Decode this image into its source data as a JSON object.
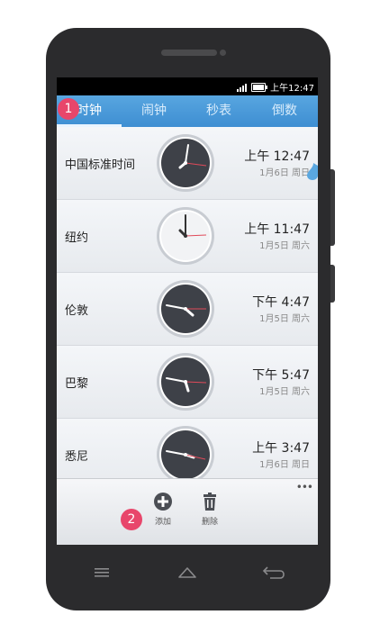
{
  "status_bar": {
    "time": "上午12:47"
  },
  "tabs": [
    {
      "label": "时钟",
      "active": true
    },
    {
      "label": "闹钟",
      "active": false
    },
    {
      "label": "秒表",
      "active": false
    },
    {
      "label": "倒数",
      "active": false
    }
  ],
  "world_clocks": [
    {
      "city": "中国标准时间",
      "time": "上午 12:47",
      "date": "1月6日 周日",
      "face": "dark"
    },
    {
      "city": "纽约",
      "time": "上午 11:47",
      "date": "1月5日 周六",
      "face": "light"
    },
    {
      "city": "伦敦",
      "time": "下午 4:47",
      "date": "1月5日 周六",
      "face": "dark"
    },
    {
      "city": "巴黎",
      "time": "下午 5:47",
      "date": "1月5日 周六",
      "face": "dark"
    },
    {
      "city": "悉尼",
      "time": "上午 3:47",
      "date": "1月6日 周日",
      "face": "dark"
    }
  ],
  "toolbar": {
    "add_label": "添加",
    "delete_label": "删除",
    "more_label": "•••"
  },
  "badges": {
    "first": "1",
    "second": "2"
  },
  "icons": {
    "add": "plus-circle-icon",
    "delete": "trash-icon",
    "more": "more-dots-icon",
    "menu": "menu-icon",
    "home": "home-icon",
    "back": "back-arrow-icon"
  },
  "colors": {
    "accent": "#4a9bdb",
    "badge": "#e8466b"
  }
}
